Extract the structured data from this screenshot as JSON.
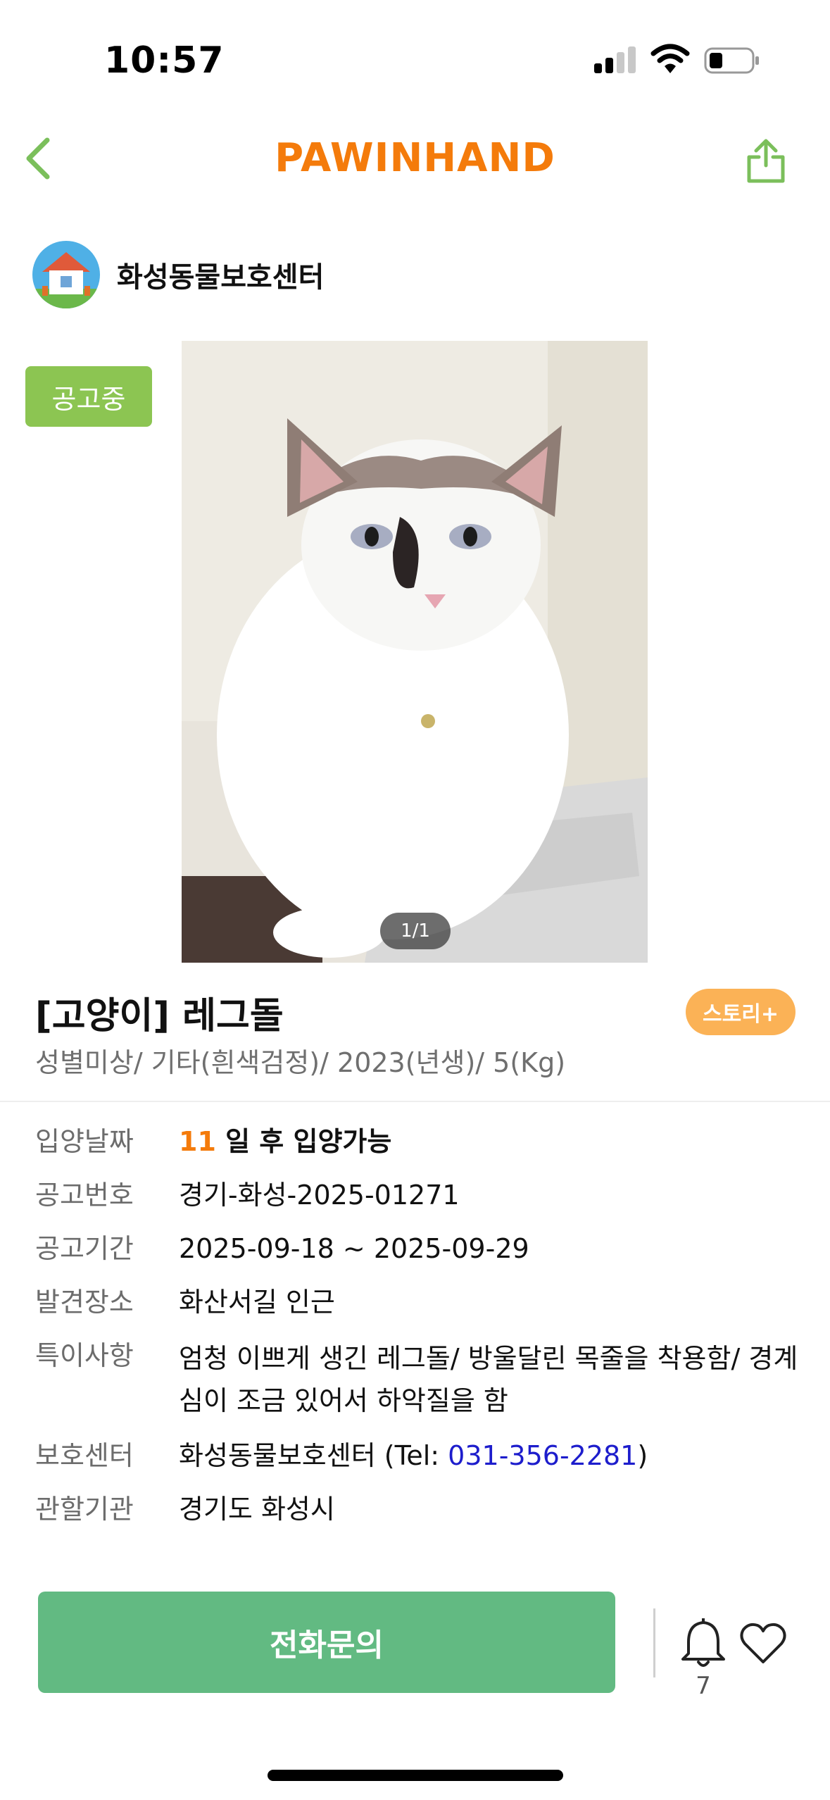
{
  "status_bar": {
    "time": "10:57"
  },
  "header": {
    "brand": "PAWINHAND",
    "back_icon": "chevron-left-icon",
    "share_icon": "share-icon",
    "accent": "#f47b0b",
    "icon_color": "#7bbf5b"
  },
  "shelter": {
    "name": "화성동물보호센터"
  },
  "badge": {
    "label": "공고중",
    "color": "#8cc552"
  },
  "photo": {
    "counter": "1/1"
  },
  "animal": {
    "title": "[고양이] 레그돌",
    "story_button": "스토리+",
    "subtitle": "성별미상/ 기타(흰색검정)/ 2023(년생)/ 5(Kg)"
  },
  "info": {
    "adopt_date": {
      "label": "입양날짜",
      "days": "11",
      "text": " 일 후 입양가능"
    },
    "notice_no": {
      "label": "공고번호",
      "value": "경기-화성-2025-01271"
    },
    "notice_period": {
      "label": "공고기간",
      "value": "2025-09-18 ~ 2025-09-29"
    },
    "found_place": {
      "label": "발견장소",
      "value": "화산서길 인근"
    },
    "notes": {
      "label": "특이사항",
      "value": "엄청 이쁘게 생긴 레그돌/ 방울달린 목줄을 착용함/ 경계심이 조금 있어서 하악질을 함"
    },
    "shelter": {
      "label": "보호센터",
      "name": "화성동물보호센터 (Tel: ",
      "tel": "031-356-2281",
      "close": ")"
    },
    "authority": {
      "label": "관할기관",
      "value": "경기도 화성시"
    }
  },
  "bottom": {
    "call_button": "전화문의",
    "bell_count": "7",
    "button_color": "#62ba82"
  }
}
